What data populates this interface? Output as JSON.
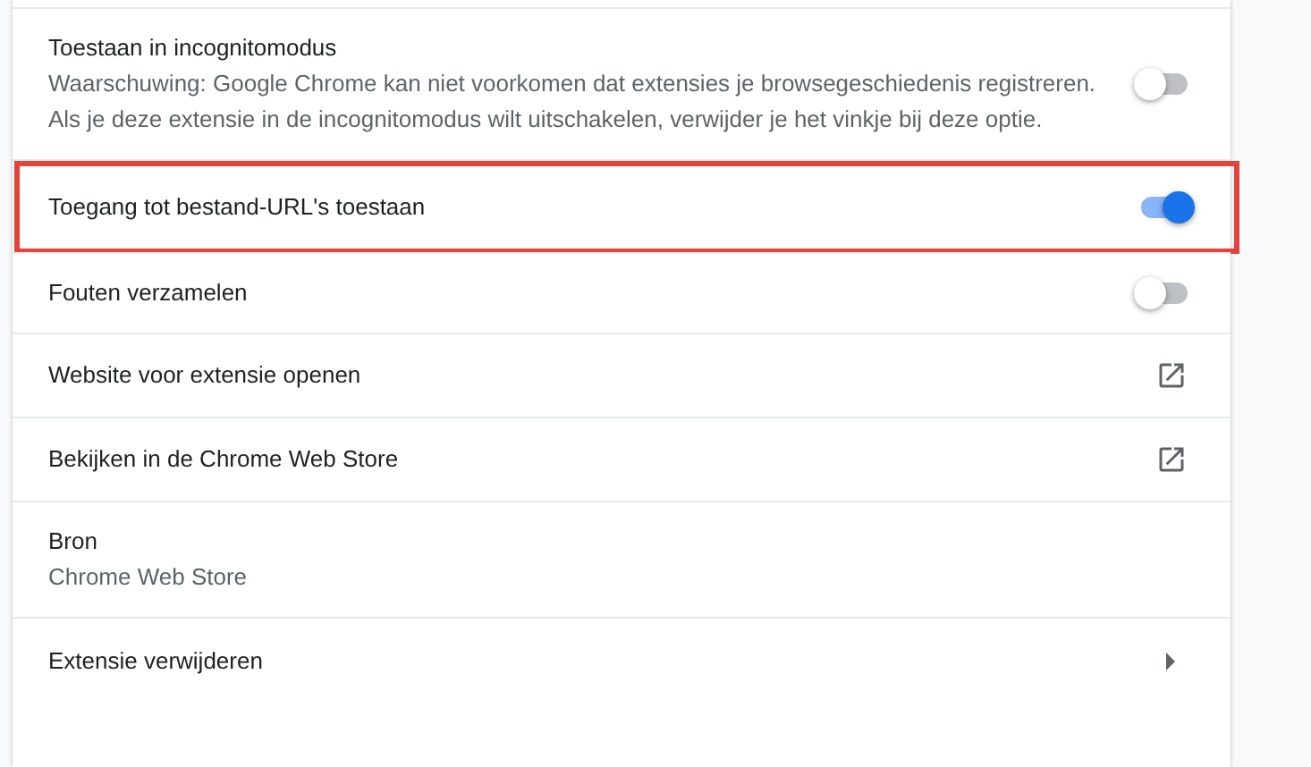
{
  "rows": [
    {
      "kind": "toggle",
      "label": "Toestaan in incognitomodus",
      "description": "Waarschuwing: Google Chrome kan niet voorkomen dat extensies je browsegeschiedenis registreren. Als je deze extensie in de incognitomodus wilt uitschakelen, verwijder je het vinkje bij deze optie.",
      "on": false,
      "highlighted": false
    },
    {
      "kind": "toggle",
      "label": "Toegang tot bestand-URL's toestaan",
      "on": true,
      "highlighted": true
    },
    {
      "kind": "toggle",
      "label": "Fouten verzamelen",
      "on": false,
      "highlighted": false
    },
    {
      "kind": "link",
      "label": "Website voor extensie openen",
      "highlighted": false
    },
    {
      "kind": "link",
      "label": "Bekijken in de Chrome Web Store",
      "highlighted": false
    },
    {
      "kind": "info",
      "label": "Bron",
      "value": "Chrome Web Store",
      "highlighted": false
    },
    {
      "kind": "submenu",
      "label": "Extensie verwijderen",
      "highlighted": false
    }
  ]
}
